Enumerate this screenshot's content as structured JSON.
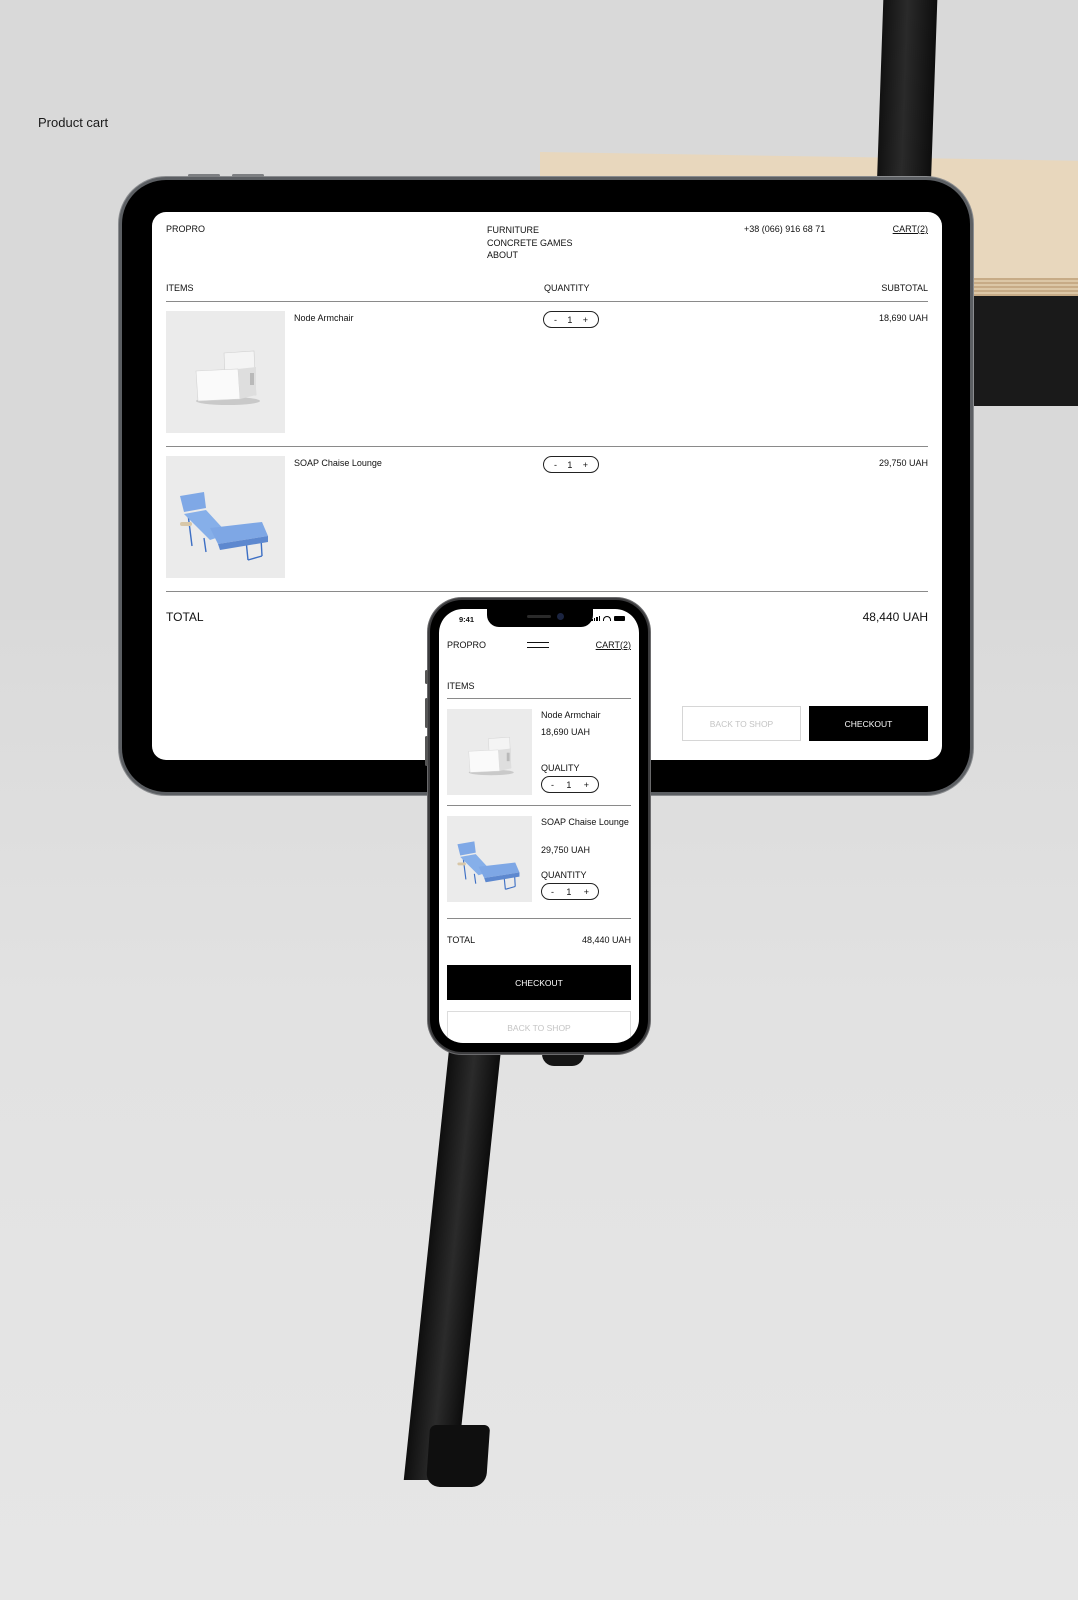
{
  "page_caption": "Product cart",
  "tablet": {
    "logo": "PROPRO",
    "nav": [
      "FURNITURE",
      "CONCRETE GAMES",
      "ABOUT"
    ],
    "phone": "+38 (066) 916 68 71",
    "cart_link": "CART(2)",
    "columns": {
      "items": "ITEMS",
      "quantity": "QUANTITY",
      "subtotal": "SUBTOTAL"
    },
    "items": [
      {
        "name": "Node Armchair",
        "quantity": "1",
        "subtotal": "18,690 UAH",
        "image": "white-armchair"
      },
      {
        "name": "SOAP Chaise Lounge",
        "quantity": "1",
        "subtotal": "29,750 UAH",
        "image": "blue-chaise-lounge"
      }
    ],
    "stepper": {
      "minus": "-",
      "plus": "+"
    },
    "total_label": "TOTAL",
    "total_value": "48,440 UAH",
    "back_button": "BACK TO SHOP",
    "checkout_button": "CHECKOUT"
  },
  "phone": {
    "status_time": "9:41",
    "logo": "PROPRO",
    "menu_icon": "hamburger-menu-icon",
    "cart_link": "CART(2)",
    "items_heading": "ITEMS",
    "items": [
      {
        "name": "Node Armchair",
        "price": "18,690 UAH",
        "quantity_label": "QUALITY",
        "quantity": "1",
        "image": "white-armchair"
      },
      {
        "name": "SOAP Chaise Lounge",
        "price": "29,750 UAH",
        "quantity_label": "QUANTITY",
        "quantity": "1",
        "image": "blue-chaise-lounge"
      }
    ],
    "stepper": {
      "minus": "-",
      "plus": "+"
    },
    "total_label": "TOTAL",
    "total_value": "48,440 UAH",
    "checkout_button": "CHECKOUT",
    "back_button": "BACK TO SHOP"
  }
}
